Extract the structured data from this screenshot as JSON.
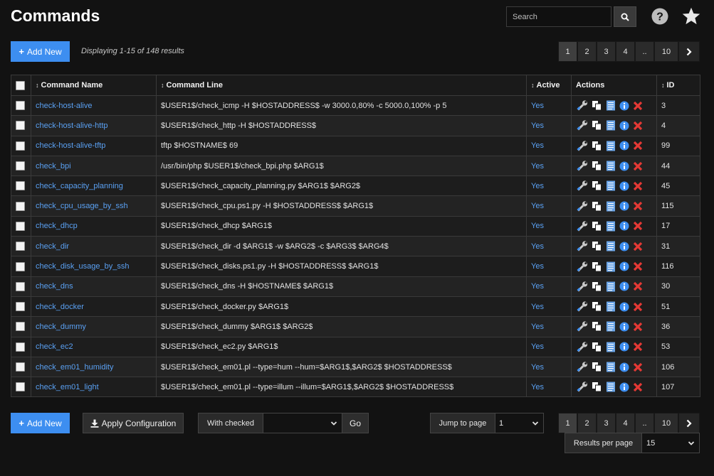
{
  "header": {
    "title": "Commands",
    "search_placeholder": "Search",
    "search_icon": "search-icon",
    "help_icon": "help-icon",
    "favorite_icon": "star-icon"
  },
  "toolbar": {
    "add_new_label": "Add New",
    "display_info": "Displaying 1-15 of 148 results"
  },
  "pagination": {
    "pages": [
      "1",
      "2",
      "3",
      "4",
      "..",
      "10"
    ],
    "current": "1",
    "next_icon": "chevron-right-icon"
  },
  "table": {
    "columns": {
      "name": "Command Name",
      "line": "Command Line",
      "active": "Active",
      "actions": "Actions",
      "id": "ID"
    },
    "action_icons": [
      "wrench-icon",
      "copy-icon",
      "document-icon",
      "info-icon",
      "delete-icon"
    ],
    "rows": [
      {
        "name": "check-host-alive",
        "line": "$USER1$/check_icmp -H $HOSTADDRESS$ -w 3000.0,80% -c 5000.0,100% -p 5",
        "active": "Yes",
        "id": "3"
      },
      {
        "name": "check-host-alive-http",
        "line": "$USER1$/check_http -H $HOSTADDRESS$",
        "active": "Yes",
        "id": "4"
      },
      {
        "name": "check-host-alive-tftp",
        "line": "tftp $HOSTNAME$ 69",
        "active": "Yes",
        "id": "99"
      },
      {
        "name": "check_bpi",
        "line": "/usr/bin/php $USER1$/check_bpi.php $ARG1$",
        "active": "Yes",
        "id": "44"
      },
      {
        "name": "check_capacity_planning",
        "line": "$USER1$/check_capacity_planning.py $ARG1$ $ARG2$",
        "active": "Yes",
        "id": "45"
      },
      {
        "name": "check_cpu_usage_by_ssh",
        "line": "$USER1$/check_cpu.ps1.py -H $HOSTADDRESS$ $ARG1$",
        "active": "Yes",
        "id": "115"
      },
      {
        "name": "check_dhcp",
        "line": "$USER1$/check_dhcp $ARG1$",
        "active": "Yes",
        "id": "17"
      },
      {
        "name": "check_dir",
        "line": "$USER1$/check_dir -d $ARG1$ -w $ARG2$ -c $ARG3$ $ARG4$",
        "active": "Yes",
        "id": "31"
      },
      {
        "name": "check_disk_usage_by_ssh",
        "line": "$USER1$/check_disks.ps1.py -H $HOSTADDRESS$ $ARG1$",
        "active": "Yes",
        "id": "116"
      },
      {
        "name": "check_dns",
        "line": "$USER1$/check_dns -H $HOSTNAME$ $ARG1$",
        "active": "Yes",
        "id": "30"
      },
      {
        "name": "check_docker",
        "line": "$USER1$/check_docker.py $ARG1$",
        "active": "Yes",
        "id": "51"
      },
      {
        "name": "check_dummy",
        "line": "$USER1$/check_dummy $ARG1$ $ARG2$",
        "active": "Yes",
        "id": "36"
      },
      {
        "name": "check_ec2",
        "line": "$USER1$/check_ec2.py $ARG1$",
        "active": "Yes",
        "id": "53"
      },
      {
        "name": "check_em01_humidity",
        "line": "$USER1$/check_em01.pl --type=hum --hum=$ARG1$,$ARG2$ $HOSTADDRESS$",
        "active": "Yes",
        "id": "106"
      },
      {
        "name": "check_em01_light",
        "line": "$USER1$/check_em01.pl --type=illum --illum=$ARG1$,$ARG2$ $HOSTADDRESS$",
        "active": "Yes",
        "id": "107"
      }
    ]
  },
  "footer": {
    "add_new_label": "Add New",
    "apply_label": "Apply Configuration",
    "with_checked_label": "With checked",
    "with_checked_value": "",
    "go_label": "Go",
    "jump_label": "Jump to page",
    "jump_value": "1",
    "rpp_label": "Results per page",
    "rpp_value": "15"
  },
  "colors": {
    "background": "#121212",
    "primary": "#3d8ef0",
    "link": "#5aa0f2",
    "delete": "#e53935",
    "info": "#3d8ef0"
  }
}
